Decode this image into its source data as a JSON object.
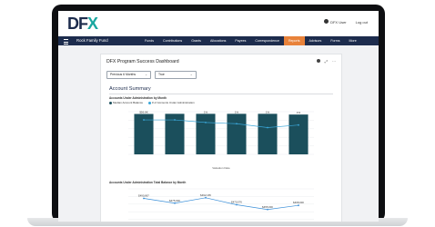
{
  "app": {
    "logo_left": "DF",
    "logo_right": "X",
    "user_label": "DFX User",
    "logout_label": "Log out",
    "org_name": "Rock Family Fund"
  },
  "nav": {
    "items": [
      "Funds",
      "Contributions",
      "Grants",
      "Allocations",
      "Payees",
      "Correspondence",
      "Reports",
      "Advisors",
      "Forms",
      "More"
    ],
    "active_index": 6,
    "active_color": "#e8823a",
    "bar_color": "#1d2c4d"
  },
  "dashboard": {
    "title": "DFX Program Success Dashboard",
    "filters": [
      {
        "value": "Previous 6 Months"
      },
      {
        "value": "True"
      }
    ],
    "section_title": "Account Summary"
  },
  "chart_data": [
    {
      "type": "bar",
      "title": "Accounts Under Administration by Month",
      "legend": [
        "Median Account Balance",
        "# of Accounts Under Administration"
      ],
      "bar_values": [
        56.8,
        57,
        57,
        57,
        57,
        56
      ],
      "data_labels": [
        "$56.8K",
        "",
        "1%",
        "1%",
        "1%",
        "1%"
      ],
      "line_values": [
        0.95,
        0.95,
        0.93,
        0.92,
        0.89,
        0.91
      ],
      "xlabel": "Valuation Date",
      "bar_color": "#1b4f5c",
      "line_color": "#3aa6d8"
    },
    {
      "type": "line",
      "title": "Accounts Under Administration Total Balance by Month",
      "values": [
        490,
        475,
        492,
        470,
        455,
        468
      ],
      "data_labels": [
        "$490,867",
        "$475,000",
        "$492,165",
        "$470,576",
        "$455,000",
        "$468,000"
      ],
      "line_color": "#3a8fd8"
    }
  ]
}
